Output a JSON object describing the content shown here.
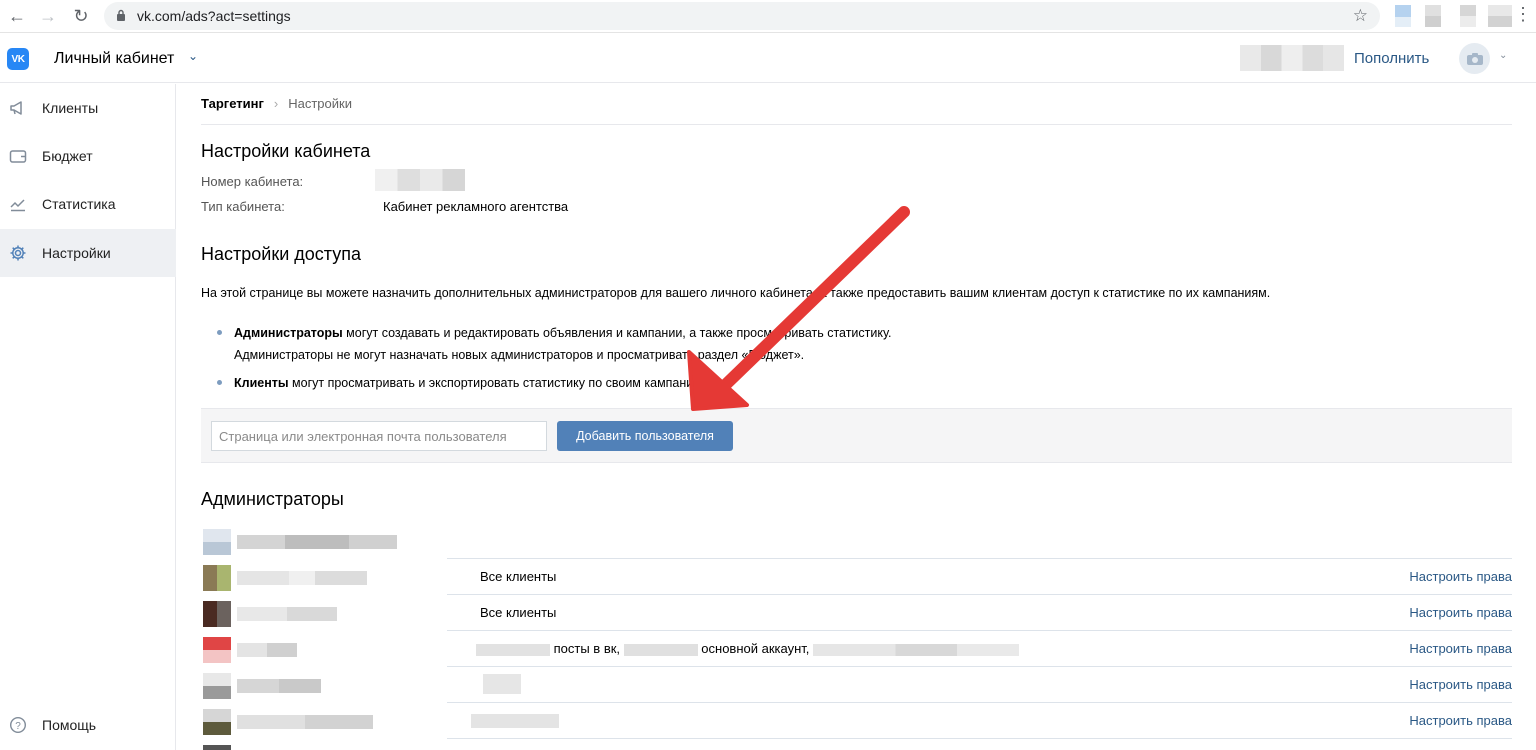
{
  "browser": {
    "url": "vk.com/ads?act=settings"
  },
  "header": {
    "title": "Личный кабинет",
    "topup_label": "Пополнить"
  },
  "sidebar": {
    "items": [
      {
        "label": "Клиенты",
        "icon": "megaphone-icon"
      },
      {
        "label": "Бюджет",
        "icon": "wallet-icon"
      },
      {
        "label": "Статистика",
        "icon": "chart-icon"
      },
      {
        "label": "Настройки",
        "icon": "gear-icon",
        "active": true
      }
    ],
    "help_label": "Помощь"
  },
  "breadcrumb": {
    "root": "Таргетинг",
    "separator": "›",
    "current": "Настройки"
  },
  "cabinet_settings": {
    "heading": "Настройки кабинета",
    "number_label": "Номер кабинета:",
    "type_label": "Тип кабинета:",
    "type_value": "Кабинет рекламного агентства"
  },
  "access_settings": {
    "heading": "Настройки доступа",
    "description": "На этой странице вы можете назначить дополнительных администраторов для вашего личного кабинета, а также предоставить вашим клиентам доступ к статистике по их кампаниям.",
    "bullet1_bold": "Администраторы",
    "bullet1_rest": " могут создавать и редактировать объявления и кампании, а также просматривать статистику.",
    "bullet1_line2": "Администраторы не могут назначать новых администраторов и просматривать раздел «Бюджет».",
    "bullet2_bold": "Клиенты",
    "bullet2_rest": " могут просматривать и экспортировать статистику по своим кампаниям."
  },
  "add_user": {
    "placeholder": "Страница или электронная почта пользователя",
    "button_label": "Добавить пользователя"
  },
  "admins": {
    "heading": "Администраторы",
    "rows": [
      {
        "access": "Все клиенты",
        "action": "Настроить права"
      },
      {
        "access": "Все клиенты",
        "action": "Настроить права"
      },
      {
        "access_part1": "посты в вк,",
        "access_part2": "основной аккаунт,",
        "action": "Настроить права"
      },
      {
        "access": "",
        "action": "Настроить права"
      },
      {
        "access": "",
        "action": "Настроить права"
      }
    ]
  },
  "colors": {
    "vk_blue": "#2787f5",
    "link": "#2a5885",
    "button": "#5181b8",
    "arrow": "#e53935"
  }
}
